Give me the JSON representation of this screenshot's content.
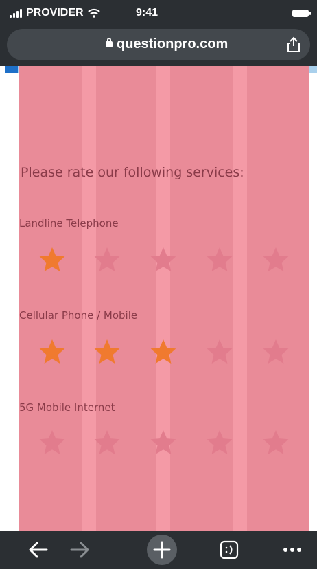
{
  "status_bar": {
    "carrier": "PROVIDER",
    "time": "9:41"
  },
  "browser": {
    "url": "questionpro.com"
  },
  "survey": {
    "heading": "Please rate our following services:",
    "questions": [
      {
        "label": "Landline Telephone",
        "rating": 1,
        "max": 5
      },
      {
        "label": "Cellular Phone / Mobile",
        "rating": 3,
        "max": 5
      },
      {
        "label": "5G Mobile Internet",
        "rating": 0,
        "max": 5
      }
    ]
  },
  "colors": {
    "star_filled": "#f07a2f",
    "star_empty": "#e27c8d",
    "overlay": "#e98b98"
  },
  "toolbar": {
    "icons": [
      "back-arrow-icon",
      "forward-arrow-icon",
      "new-tab-plus-icon",
      "tabs-icon",
      "more-icon"
    ]
  }
}
